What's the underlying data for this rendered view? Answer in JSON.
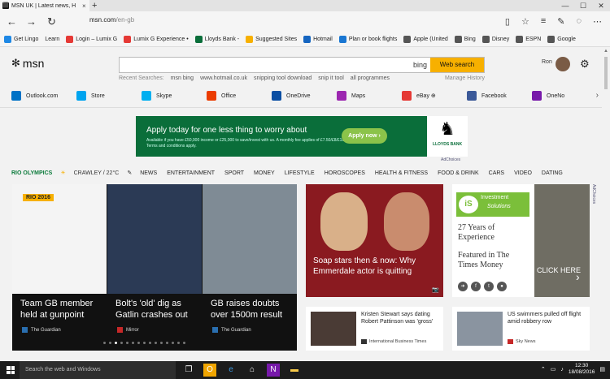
{
  "browser": {
    "tab_title": "MSN UK | Latest news, H",
    "tab_close": "×",
    "new_tab": "+",
    "window_controls": [
      "—",
      "☐",
      "✕"
    ],
    "address_host": "msn.com",
    "address_path": "/en-gb",
    "nav": {
      "back": "←",
      "forward": "→",
      "refresh": "↻"
    },
    "right_icons": [
      "▯",
      "☆",
      "≡",
      "✎",
      "◌",
      "⋯"
    ]
  },
  "favorites": [
    {
      "label": "Get Lingo",
      "color": "#1e88e5"
    },
    {
      "label": "Learn",
      "color": ""
    },
    {
      "label": "Login – Lumix G",
      "color": "#e53935"
    },
    {
      "label": "Lumix G Experience •",
      "color": "#e53935"
    },
    {
      "label": "Lloyds Bank -",
      "color": "#0a6e3a"
    },
    {
      "label": "Suggested Sites",
      "color": "#f7b000"
    },
    {
      "label": "Hotmail",
      "color": "#1565c0"
    },
    {
      "label": "Plan or book flights",
      "color": "#1976d2"
    },
    {
      "label": "Apple (United",
      "color": "#555"
    },
    {
      "label": "Bing",
      "color": "#555"
    },
    {
      "label": "Disney",
      "color": "#555"
    },
    {
      "label": "ESPN",
      "color": "#555"
    },
    {
      "label": "Google",
      "color": "#555"
    }
  ],
  "msn": {
    "logo": "msn",
    "search_placeholder": "",
    "bing": "bing",
    "search_button": "Web search",
    "recent_label": "Recent Searches:",
    "recent": [
      "msn bing",
      "www.hotmail.co.uk",
      "snipping tool download",
      "snip it tool",
      "all programmes"
    ],
    "manage_history": "Manage History",
    "user": "Ron",
    "settings_icon": "⚙"
  },
  "apps": [
    {
      "label": "Outlook.com",
      "color": "#0072c6"
    },
    {
      "label": "Store",
      "color": "#00a4ef"
    },
    {
      "label": "Skype",
      "color": "#00aff0"
    },
    {
      "label": "Office",
      "color": "#eb3c00"
    },
    {
      "label": "OneDrive",
      "color": "#0a4ea3"
    },
    {
      "label": "Maps",
      "color": "#9c27b0"
    },
    {
      "label": "eBay ⊕",
      "color": "#e53935"
    },
    {
      "label": "Facebook",
      "color": "#3b5998"
    },
    {
      "label": "OneNo",
      "color": "#7719aa"
    }
  ],
  "ad": {
    "headline": "Apply today for one less thing to worry about",
    "small": "Available if you have £50,000 income or £25,000 to save/invest with us. A monthly fee applies of £7.50/£8/£15/£8. Terms and conditions apply.",
    "cta": "Apply now ›",
    "bank": "LLOYDS BANK",
    "adchoices": "AdChoices"
  },
  "categories": {
    "rio": "RIO OLYMPICS",
    "weather": "CRAWLEY / 22°C",
    "items": [
      "NEWS",
      "ENTERTAINMENT",
      "SPORT",
      "MONEY",
      "LIFESTYLE",
      "HOROSCOPES",
      "HEALTH & FITNESS",
      "FOOD & DRINK",
      "CARS",
      "VIDEO",
      "DATING"
    ]
  },
  "hero": {
    "badge": "RIO 2016",
    "slides": [
      {
        "caption": "Team GB member held at gunpoint",
        "source": "The Guardian",
        "color": "#f4f4f4"
      },
      {
        "caption": "Bolt's 'old' dig as Gatlin crashes out",
        "source": "Mirror",
        "color": "#2b3a55"
      },
      {
        "caption": "GB raises doubts over 1500m result",
        "source": "The Guardian",
        "color": "#7f8b95"
      }
    ],
    "dot_count": 15,
    "active_dot": 2
  },
  "soap": {
    "caption": "Soap stars then & now: Why Emmerdale actor is quitting",
    "camera": "📷"
  },
  "times_ad": {
    "logo_short": "iS",
    "logo_line1": "Investment",
    "logo_line2": "Solutions",
    "line1": "27 Years of Experience",
    "line2": "Featured in The Times Money",
    "click": "CLICK HERE",
    "arrow": "›",
    "adchoices": "AdChoices"
  },
  "news": [
    {
      "headline": "Kristen Stewart says dating Robert Pattinson was 'gross'",
      "source": "International Business Times",
      "color": "#4a3b35"
    },
    {
      "headline": "US swimmers pulled off flight amid robbery row",
      "source": "Sky News",
      "color": "#8a94a0"
    }
  ],
  "taskbar": {
    "search": "Search the web and Windows",
    "time": "12:30",
    "date": "18/08/2016"
  }
}
